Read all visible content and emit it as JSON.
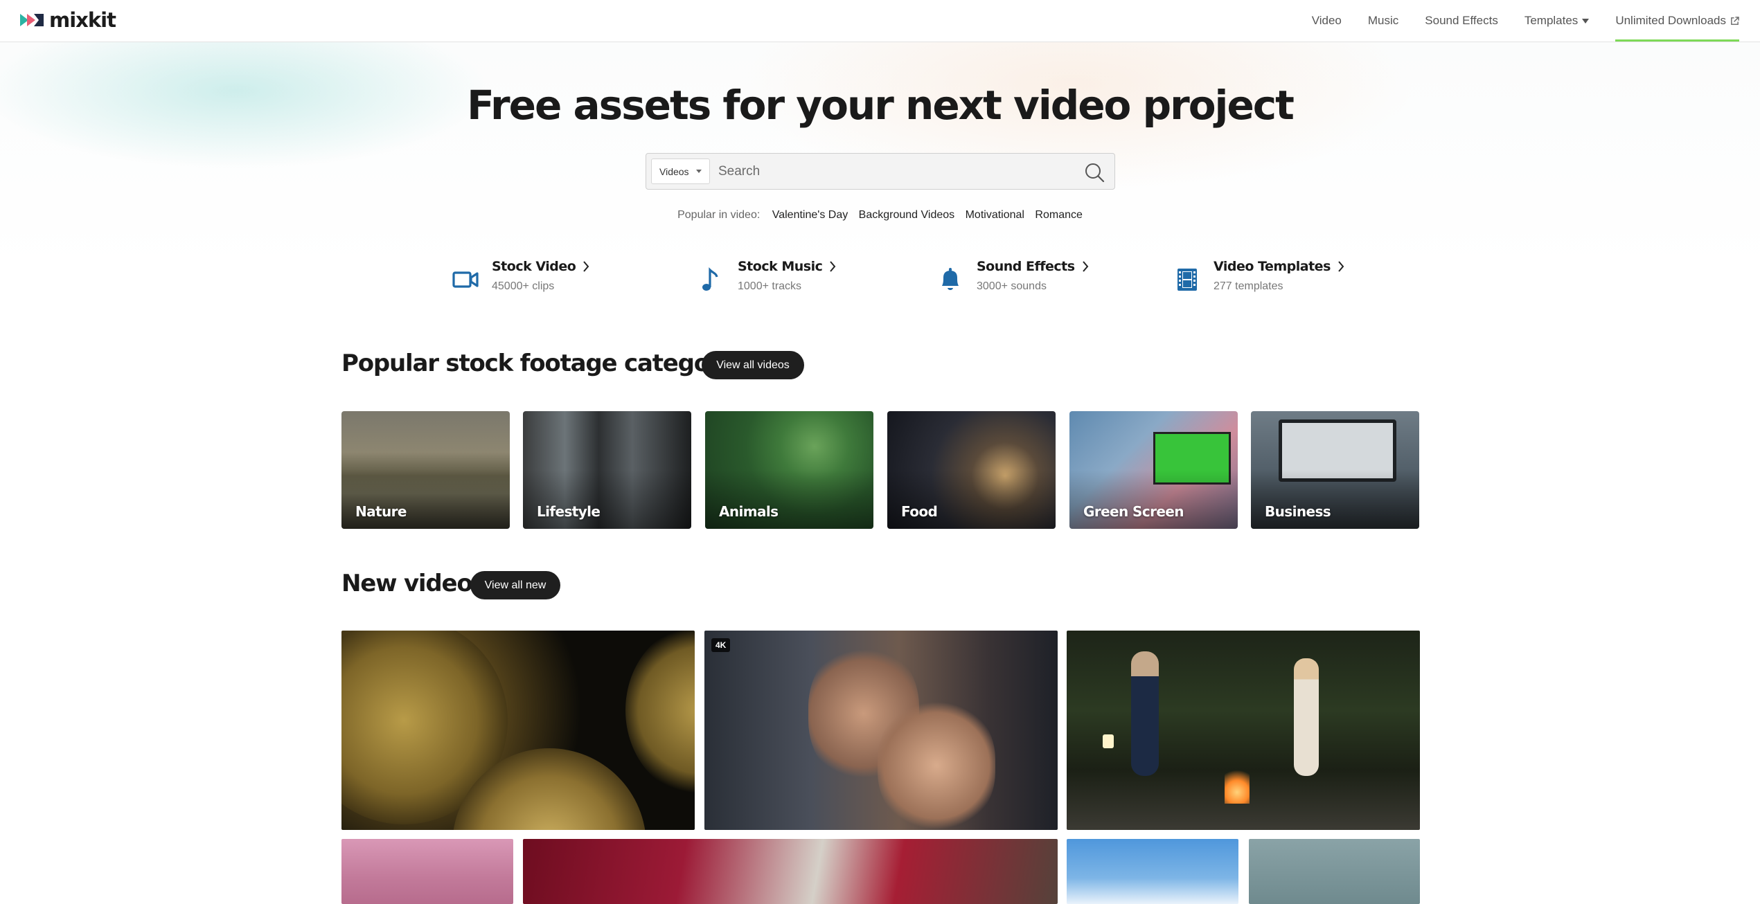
{
  "header": {
    "logo_text": "mixkit",
    "nav": [
      {
        "label": "Video"
      },
      {
        "label": "Music"
      },
      {
        "label": "Sound Effects"
      },
      {
        "label": "Templates"
      },
      {
        "label": "Unlimited Downloads"
      }
    ]
  },
  "hero": {
    "title": "Free assets for your next video project",
    "search": {
      "selected_type": "Videos",
      "placeholder": "Search",
      "value": ""
    },
    "popular": {
      "lead": "Popular in video:",
      "tags": [
        "Valentine's Day",
        "Background Videos",
        "Motivational",
        "Romance"
      ]
    }
  },
  "asset_types": [
    {
      "title": "Stock Video",
      "sub": "45000+ clips",
      "icon": "video-camera-icon"
    },
    {
      "title": "Stock Music",
      "sub": "1000+ tracks",
      "icon": "music-note-icon"
    },
    {
      "title": "Sound Effects",
      "sub": "3000+ sounds",
      "icon": "bell-icon"
    },
    {
      "title": "Video Templates",
      "sub": "277 templates",
      "icon": "film-strip-icon"
    }
  ],
  "categories_section": {
    "title": "Popular stock footage categories",
    "button": "View all videos",
    "items": [
      {
        "label": "Nature"
      },
      {
        "label": "Lifestyle"
      },
      {
        "label": "Animals"
      },
      {
        "label": "Food"
      },
      {
        "label": "Green Screen"
      },
      {
        "label": "Business"
      }
    ]
  },
  "new_videos": {
    "title": "New videos",
    "button": "View all new",
    "badge": "4K"
  },
  "colors": {
    "accent": "#7ed957",
    "icon_blue": "#1f6aa8",
    "dark_pill": "#1f1f1f"
  }
}
